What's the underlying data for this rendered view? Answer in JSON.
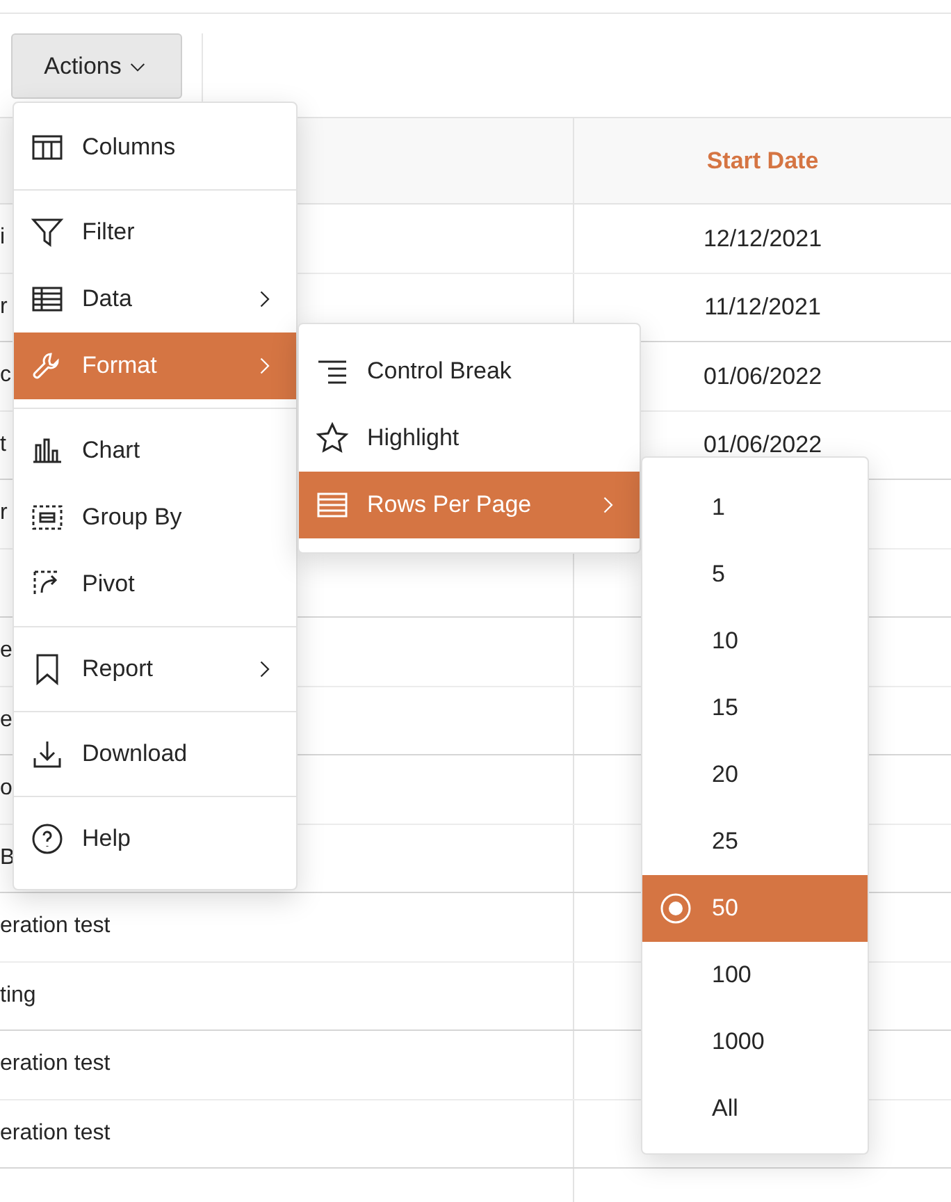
{
  "toolbar": {
    "actions_button": "Actions"
  },
  "table": {
    "columns": [
      {
        "label": "Start Date"
      }
    ],
    "rows": [
      {
        "column_1": "i",
        "start_date": "12/12/2021"
      },
      {
        "column_1": "r",
        "start_date": "11/12/2021"
      },
      {
        "column_1": "c",
        "start_date": "01/06/2022"
      },
      {
        "column_1": "t",
        "start_date": "01/06/2022"
      },
      {
        "column_1": "r"
      },
      {},
      {
        "column_1": "e"
      },
      {
        "column_1": "e"
      },
      {
        "column_1": "o"
      },
      {
        "column_1": "B"
      },
      {
        "column_1": "eration test"
      },
      {
        "column_1": "ting"
      },
      {
        "column_1": "eration test"
      },
      {
        "column_1": "eration test"
      },
      {}
    ]
  },
  "actions_menu": {
    "items": [
      {
        "kind": "item",
        "label": "Columns",
        "submenu": false,
        "selected": false
      },
      {
        "kind": "divider"
      },
      {
        "kind": "item",
        "label": "Filter",
        "submenu": false,
        "selected": false
      },
      {
        "kind": "item",
        "label": "Data",
        "submenu": true,
        "selected": false
      },
      {
        "kind": "item",
        "label": "Format",
        "submenu": true,
        "selected": true
      },
      {
        "kind": "divider"
      },
      {
        "kind": "item",
        "label": "Chart",
        "submenu": false,
        "selected": false
      },
      {
        "kind": "item",
        "label": "Group By",
        "submenu": false,
        "selected": false
      },
      {
        "kind": "item",
        "label": "Pivot",
        "submenu": false,
        "selected": false
      },
      {
        "kind": "divider"
      },
      {
        "kind": "item",
        "label": "Report",
        "submenu": true,
        "selected": false
      },
      {
        "kind": "divider"
      },
      {
        "kind": "item",
        "label": "Download",
        "submenu": false,
        "selected": false
      },
      {
        "kind": "divider"
      },
      {
        "kind": "item",
        "label": "Help",
        "submenu": false,
        "selected": false
      }
    ]
  },
  "format_menu": {
    "items": [
      {
        "label": "Control Break",
        "submenu": false,
        "selected": false
      },
      {
        "label": "Highlight",
        "submenu": false,
        "selected": false
      },
      {
        "label": "Rows Per Page",
        "submenu": true,
        "selected": true
      }
    ]
  },
  "rows_per_page_menu": {
    "options": [
      {
        "label": "1",
        "selected": false
      },
      {
        "label": "5",
        "selected": false
      },
      {
        "label": "10",
        "selected": false
      },
      {
        "label": "15",
        "selected": false
      },
      {
        "label": "20",
        "selected": false
      },
      {
        "label": "25",
        "selected": false
      },
      {
        "label": "50",
        "selected": true
      },
      {
        "label": "100",
        "selected": false
      },
      {
        "label": "1000",
        "selected": false
      },
      {
        "label": "All",
        "selected": false
      }
    ]
  }
}
